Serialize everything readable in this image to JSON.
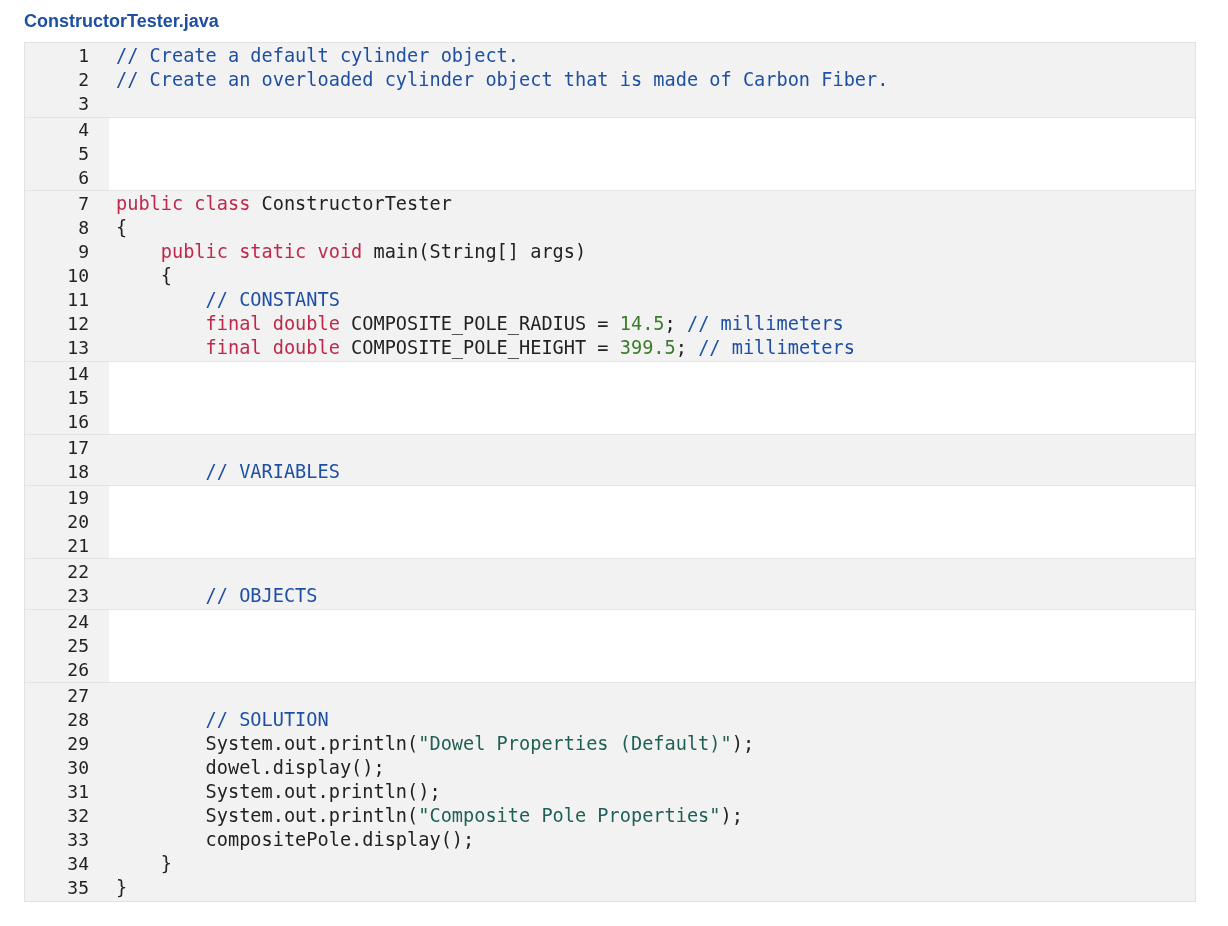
{
  "file_title": "ConstructorTester.java",
  "blocks": [
    {
      "kind": "readonly",
      "lines": [
        {
          "number": "1",
          "tokens": [
            {
              "kind": "comment",
              "text": "// Create a default cylinder object."
            }
          ]
        },
        {
          "number": "2",
          "tokens": [
            {
              "kind": "comment",
              "text": "// Create an overloaded cylinder object that is made of Carbon Fiber."
            }
          ]
        },
        {
          "number": "3"
        }
      ]
    },
    {
      "kind": "editable",
      "lines": [
        {
          "number": "4"
        },
        {
          "number": "5"
        },
        {
          "number": "6"
        }
      ]
    },
    {
      "kind": "readonly",
      "lines": [
        {
          "number": "7",
          "tokens": [
            {
              "kind": "keyword",
              "text": "public class"
            },
            {
              "kind": "plain",
              "text": " ConstructorTester"
            }
          ]
        },
        {
          "number": "8",
          "tokens": [
            {
              "kind": "plain",
              "text": "{"
            }
          ]
        },
        {
          "number": "9",
          "tokens": [
            {
              "kind": "keyword",
              "text": "    public static void"
            },
            {
              "kind": "plain",
              "text": " main(String[] args)"
            }
          ]
        },
        {
          "number": "10",
          "tokens": [
            {
              "kind": "plain",
              "text": "    {"
            }
          ]
        },
        {
          "number": "11",
          "tokens": [
            {
              "kind": "comment",
              "text": "        // CONSTANTS"
            }
          ]
        },
        {
          "number": "12",
          "tokens": [
            {
              "kind": "keyword",
              "text": "        final double"
            },
            {
              "kind": "plain",
              "text": " COMPOSITE_POLE_RADIUS = "
            },
            {
              "kind": "number",
              "text": "14.5"
            },
            {
              "kind": "plain",
              "text": "; "
            },
            {
              "kind": "comment",
              "text": "// millimeters"
            }
          ]
        },
        {
          "number": "13",
          "tokens": [
            {
              "kind": "keyword",
              "text": "        final double"
            },
            {
              "kind": "plain",
              "text": " COMPOSITE_POLE_HEIGHT = "
            },
            {
              "kind": "number",
              "text": "399.5"
            },
            {
              "kind": "plain",
              "text": "; "
            },
            {
              "kind": "comment",
              "text": "// millimeters"
            }
          ]
        }
      ]
    },
    {
      "kind": "editable",
      "lines": [
        {
          "number": "14"
        },
        {
          "number": "15"
        },
        {
          "number": "16"
        }
      ]
    },
    {
      "kind": "readonly",
      "lines": [
        {
          "number": "17"
        },
        {
          "number": "18",
          "tokens": [
            {
              "kind": "comment",
              "text": "        // VARIABLES"
            }
          ]
        }
      ]
    },
    {
      "kind": "editable",
      "lines": [
        {
          "number": "19"
        },
        {
          "number": "20"
        },
        {
          "number": "21"
        }
      ]
    },
    {
      "kind": "readonly",
      "lines": [
        {
          "number": "22"
        },
        {
          "number": "23",
          "tokens": [
            {
              "kind": "comment",
              "text": "        // OBJECTS"
            }
          ]
        }
      ]
    },
    {
      "kind": "editable",
      "lines": [
        {
          "number": "24"
        },
        {
          "number": "25"
        },
        {
          "number": "26"
        }
      ]
    },
    {
      "kind": "readonly",
      "lines": [
        {
          "number": "27"
        },
        {
          "number": "28",
          "tokens": [
            {
              "kind": "comment",
              "text": "        // SOLUTION"
            }
          ]
        },
        {
          "number": "29",
          "tokens": [
            {
              "kind": "plain",
              "text": "        System.out.println("
            },
            {
              "kind": "string",
              "text": "\"Dowel Properties (Default)\""
            },
            {
              "kind": "plain",
              "text": ");"
            }
          ]
        },
        {
          "number": "30",
          "tokens": [
            {
              "kind": "plain",
              "text": "        dowel.display();"
            }
          ]
        },
        {
          "number": "31",
          "tokens": [
            {
              "kind": "plain",
              "text": "        System.out.println();"
            }
          ]
        },
        {
          "number": "32",
          "tokens": [
            {
              "kind": "plain",
              "text": "        System.out.println("
            },
            {
              "kind": "string",
              "text": "\"Composite Pole Properties\""
            },
            {
              "kind": "plain",
              "text": ");"
            }
          ]
        },
        {
          "number": "33",
          "tokens": [
            {
              "kind": "plain",
              "text": "        compositePole.display();"
            }
          ]
        },
        {
          "number": "34",
          "tokens": [
            {
              "kind": "plain",
              "text": "    }"
            }
          ]
        },
        {
          "number": "35",
          "tokens": [
            {
              "kind": "plain",
              "text": "}"
            }
          ]
        }
      ]
    }
  ]
}
